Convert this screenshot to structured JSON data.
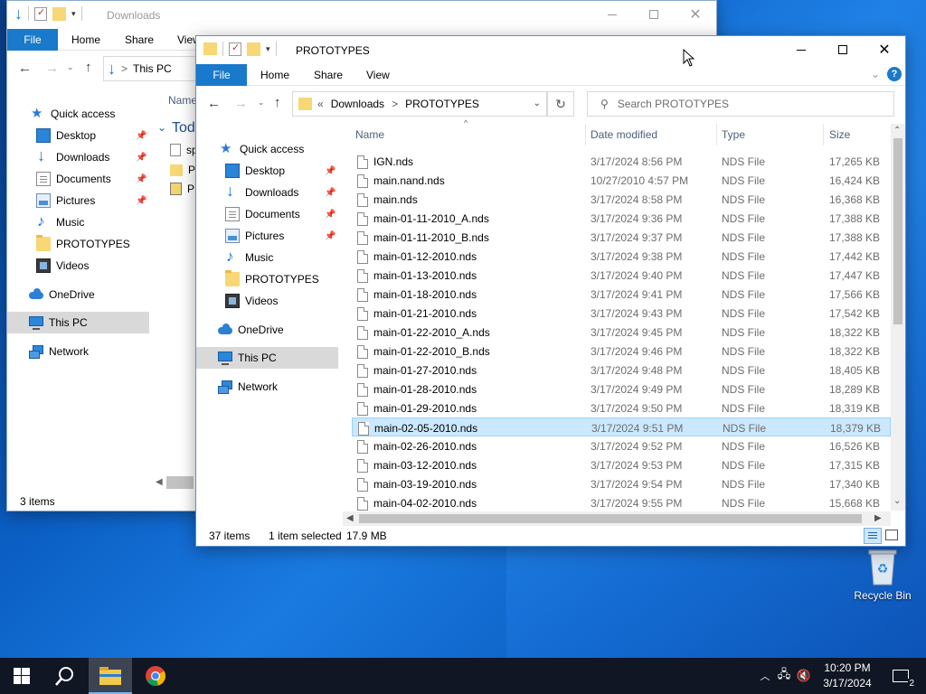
{
  "back_window": {
    "title": "Downloads",
    "ribbon": {
      "file": "File",
      "home": "Home",
      "share": "Share",
      "view": "View"
    },
    "address": {
      "location": "This PC"
    },
    "nav": [
      {
        "label": "Quick access",
        "icon": "star-icon",
        "pinned": false
      },
      {
        "label": "Desktop",
        "icon": "desktop-icon",
        "pinned": true
      },
      {
        "label": "Downloads",
        "icon": "downloads-icon",
        "pinned": true
      },
      {
        "label": "Documents",
        "icon": "documents-icon",
        "pinned": true
      },
      {
        "label": "Pictures",
        "icon": "pictures-icon",
        "pinned": true
      },
      {
        "label": "Music",
        "icon": "music-icon",
        "pinned": false
      },
      {
        "label": "PROTOTYPES",
        "icon": "folder-icon",
        "pinned": false
      },
      {
        "label": "Videos",
        "icon": "videos-icon",
        "pinned": false
      },
      {
        "label": "OneDrive",
        "icon": "onedrive-icon",
        "pinned": false
      },
      {
        "label": "This PC",
        "icon": "this-pc-icon",
        "pinned": false
      },
      {
        "label": "Network",
        "icon": "network-icon",
        "pinned": false
      }
    ],
    "col_name": "Name",
    "group_label": "Toda",
    "partial_items": [
      "sp",
      "PF",
      "PF"
    ],
    "status": "3 items"
  },
  "front_window": {
    "title": "PROTOTYPES",
    "ribbon": {
      "file": "File",
      "home": "Home",
      "share": "Share",
      "view": "View"
    },
    "address": {
      "prefix": "«",
      "part1": "Downloads",
      "sep": ">",
      "part2": "PROTOTYPES"
    },
    "search_placeholder": "Search PROTOTYPES",
    "nav": [
      {
        "label": "Quick access",
        "icon": "star-icon",
        "pinned": false
      },
      {
        "label": "Desktop",
        "icon": "desktop-icon",
        "pinned": true
      },
      {
        "label": "Downloads",
        "icon": "downloads-icon",
        "pinned": true
      },
      {
        "label": "Documents",
        "icon": "documents-icon",
        "pinned": true
      },
      {
        "label": "Pictures",
        "icon": "pictures-icon",
        "pinned": true
      },
      {
        "label": "Music",
        "icon": "music-icon",
        "pinned": false
      },
      {
        "label": "PROTOTYPES",
        "icon": "folder-icon",
        "pinned": false
      },
      {
        "label": "Videos",
        "icon": "videos-icon",
        "pinned": false
      },
      {
        "label": "OneDrive",
        "icon": "onedrive-icon",
        "pinned": false
      },
      {
        "label": "This PC",
        "icon": "this-pc-icon",
        "pinned": false
      },
      {
        "label": "Network",
        "icon": "network-icon",
        "pinned": false
      }
    ],
    "columns": {
      "name": "Name",
      "date": "Date modified",
      "type": "Type",
      "size": "Size"
    },
    "files": [
      {
        "name": "IGN.nds",
        "date": "3/17/2024 8:56 PM",
        "type": "NDS File",
        "size": "17,265 KB"
      },
      {
        "name": "main.nand.nds",
        "date": "10/27/2010 4:57 PM",
        "type": "NDS File",
        "size": "16,424 KB"
      },
      {
        "name": "main.nds",
        "date": "3/17/2024 8:58 PM",
        "type": "NDS File",
        "size": "16,368 KB"
      },
      {
        "name": "main-01-11-2010_A.nds",
        "date": "3/17/2024 9:36 PM",
        "type": "NDS File",
        "size": "17,388 KB"
      },
      {
        "name": "main-01-11-2010_B.nds",
        "date": "3/17/2024 9:37 PM",
        "type": "NDS File",
        "size": "17,388 KB"
      },
      {
        "name": "main-01-12-2010.nds",
        "date": "3/17/2024 9:38 PM",
        "type": "NDS File",
        "size": "17,442 KB"
      },
      {
        "name": "main-01-13-2010.nds",
        "date": "3/17/2024 9:40 PM",
        "type": "NDS File",
        "size": "17,447 KB"
      },
      {
        "name": "main-01-18-2010.nds",
        "date": "3/17/2024 9:41 PM",
        "type": "NDS File",
        "size": "17,566 KB"
      },
      {
        "name": "main-01-21-2010.nds",
        "date": "3/17/2024 9:43 PM",
        "type": "NDS File",
        "size": "17,542 KB"
      },
      {
        "name": "main-01-22-2010_A.nds",
        "date": "3/17/2024 9:45 PM",
        "type": "NDS File",
        "size": "18,322 KB"
      },
      {
        "name": "main-01-22-2010_B.nds",
        "date": "3/17/2024 9:46 PM",
        "type": "NDS File",
        "size": "18,322 KB"
      },
      {
        "name": "main-01-27-2010.nds",
        "date": "3/17/2024 9:48 PM",
        "type": "NDS File",
        "size": "18,405 KB"
      },
      {
        "name": "main-01-28-2010.nds",
        "date": "3/17/2024 9:49 PM",
        "type": "NDS File",
        "size": "18,289 KB"
      },
      {
        "name": "main-01-29-2010.nds",
        "date": "3/17/2024 9:50 PM",
        "type": "NDS File",
        "size": "18,319 KB"
      },
      {
        "name": "main-02-05-2010.nds",
        "date": "3/17/2024 9:51 PM",
        "type": "NDS File",
        "size": "18,379 KB",
        "selected": true
      },
      {
        "name": "main-02-26-2010.nds",
        "date": "3/17/2024 9:52 PM",
        "type": "NDS File",
        "size": "16,526 KB"
      },
      {
        "name": "main-03-12-2010.nds",
        "date": "3/17/2024 9:53 PM",
        "type": "NDS File",
        "size": "17,315 KB"
      },
      {
        "name": "main-03-19-2010.nds",
        "date": "3/17/2024 9:54 PM",
        "type": "NDS File",
        "size": "17,340 KB"
      },
      {
        "name": "main-04-02-2010.nds",
        "date": "3/17/2024 9:55 PM",
        "type": "NDS File",
        "size": "15,668 KB"
      }
    ],
    "status": {
      "count": "37 items",
      "selection": "1 item selected",
      "size": "17.9 MB"
    }
  },
  "desktop": {
    "recycle_bin": "Recycle Bin"
  },
  "taskbar": {
    "time": "10:20 PM",
    "date": "3/17/2024",
    "notifications": "2"
  },
  "colors": {
    "accent": "#1979ca",
    "selected_row": "#cce8ff",
    "taskbar": "#101623"
  }
}
